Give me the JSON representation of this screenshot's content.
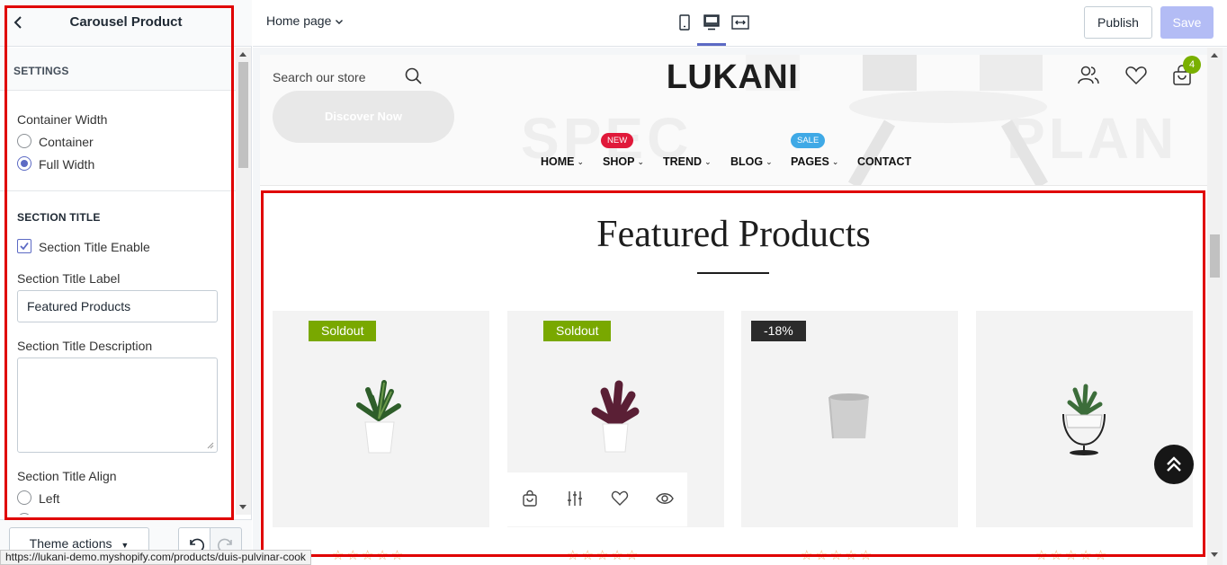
{
  "sidebar": {
    "title": "Carousel Product",
    "settings_heading": "SETTINGS",
    "container_width": {
      "label": "Container Width",
      "options": [
        "Container",
        "Full Width"
      ],
      "selected": "Full Width"
    },
    "section_title_heading": "SECTION TITLE",
    "section_title_enable": {
      "label": "Section Title Enable",
      "checked": true
    },
    "section_title_label": {
      "label": "Section Title Label",
      "value": "Featured Products"
    },
    "section_title_description": {
      "label": "Section Title Description",
      "value": ""
    },
    "section_title_align": {
      "label": "Section Title Align",
      "options": [
        "Left"
      ],
      "selected": ""
    },
    "footer": {
      "theme_actions": "Theme actions"
    }
  },
  "status_url": "https://lukani-demo.myshopify.com/products/duis-pulvinar-cook",
  "topbar": {
    "page_select": "Home page",
    "publish": "Publish",
    "save": "Save",
    "active_device": "desktop"
  },
  "store": {
    "search_placeholder": "Search our store",
    "discover_button": "Discover Now",
    "logo": "LUKANI",
    "cart_count": "4",
    "nav": [
      {
        "label": "HOME",
        "has_dropdown": true,
        "badge": ""
      },
      {
        "label": "SHOP",
        "has_dropdown": true,
        "badge": "NEW"
      },
      {
        "label": "TREND",
        "has_dropdown": true,
        "badge": ""
      },
      {
        "label": "BLOG",
        "has_dropdown": true,
        "badge": ""
      },
      {
        "label": "PAGES",
        "has_dropdown": true,
        "badge": "SALE"
      },
      {
        "label": "CONTACT",
        "has_dropdown": false,
        "badge": ""
      }
    ],
    "badge_colors": {
      "NEW": "#e0193a",
      "SALE": "#3fa9e6"
    },
    "bg_text": [
      "SPEC",
      "PLAN"
    ]
  },
  "featured": {
    "title": "Featured Products",
    "products": [
      {
        "badge": "Soldout",
        "badge_style": "green",
        "image": "potted-snake-plant"
      },
      {
        "badge": "Soldout",
        "badge_style": "green",
        "image": "potted-purple-plant",
        "hover_actions": [
          "cart-icon",
          "compare-icon",
          "heart-icon",
          "eye-icon"
        ]
      },
      {
        "badge": "-18%",
        "badge_style": "dark",
        "image": "concrete-pot"
      },
      {
        "badge": "",
        "badge_style": "",
        "image": "aloe-hanging-pot"
      }
    ],
    "rating_stars": 5
  },
  "colors": {
    "accent": "#5c6ac4",
    "save_disabled": "#b3bcf5",
    "soldout_badge": "#79a800",
    "discount_badge": "#2b2b2b",
    "annotation_red": "#e00000"
  }
}
